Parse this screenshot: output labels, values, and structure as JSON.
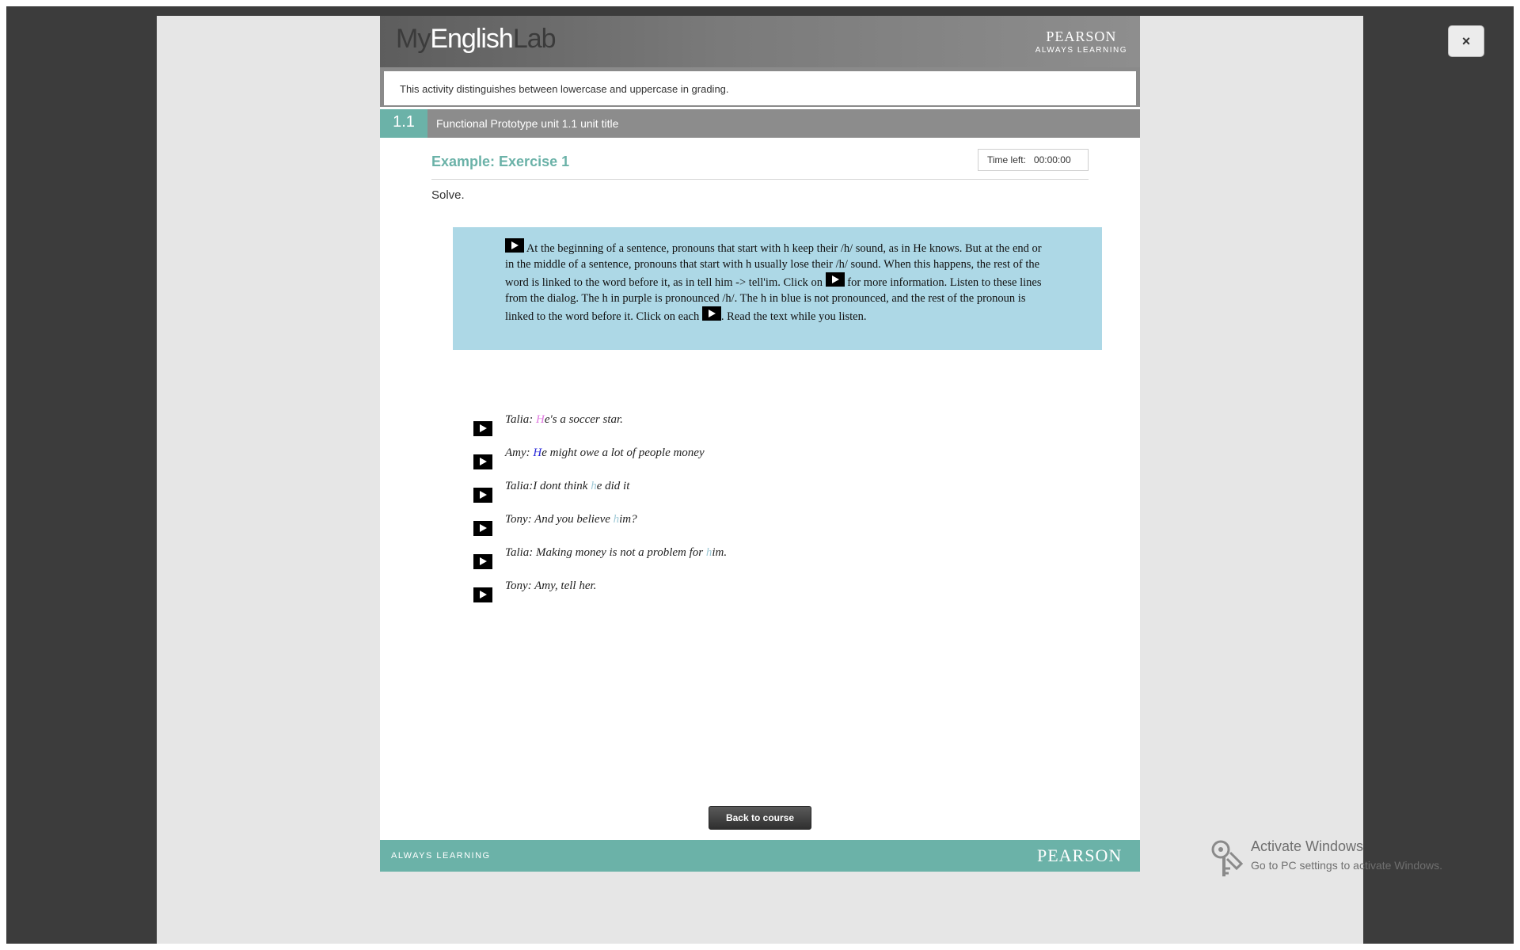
{
  "window": {
    "close_label": "×"
  },
  "header": {
    "logo_my": "My",
    "logo_english": "English",
    "logo_lab": "Lab",
    "brand": "PEARSON",
    "tagline": "ALWAYS LEARNING"
  },
  "notice": "This activity distinguishes between lowercase and uppercase in grading.",
  "unit": {
    "number": "1.1",
    "title": "Functional Prototype unit 1.1 unit title"
  },
  "exercise": {
    "title": "Example: Exercise 1",
    "timer_label": "Time left:",
    "timer_value": "00:00:00",
    "instruction": "Solve."
  },
  "info": {
    "part1": " At the beginning of a sentence, pronouns that start with h keep their /h/ sound, as in He knows. But at the end or in the middle of a sentence, pronouns that start with h usually lose their /h/ sound. When this happens, the rest of the word is linked to the word before it, as in tell him -> tell'im. Click on ",
    "part2": " for more information. Listen to these lines from the dialog. The h in purple is pronounced /h/. The h in blue is not pronounced, and the rest of the pronoun is linked to the word before it. Click on each ",
    "part3": ". Read the text while you listen."
  },
  "dialog": [
    {
      "pre": "Talia: ",
      "h": "H",
      "post": "e's a soccer star."
    },
    {
      "pre": "Amy: ",
      "h": "H",
      "post": "e might owe a lot of people money"
    },
    {
      "pre": "Talia:I dont think ",
      "h": "h",
      "post": "e did it"
    },
    {
      "pre": "Tony: And you believe ",
      "h": "h",
      "post": "im?"
    },
    {
      "pre": "Talia: Making money is not a problem for ",
      "h": "h",
      "post": "im."
    },
    {
      "pre": "Tony: Amy, tell ",
      "h": "h",
      "post": "er."
    }
  ],
  "actions": {
    "back": "Back to course"
  },
  "footer": {
    "tagline": "ALWAYS LEARNING",
    "brand": "PEARSON"
  },
  "os_overlay": {
    "title": "Activate Windows",
    "subtitle": "Go to PC settings to activate Windows."
  },
  "colors": {
    "teal": "#6bb2a8",
    "info_bg": "#add8e6",
    "h_pronounced": "#e07be0",
    "h_blue": "#2b2bd9"
  }
}
